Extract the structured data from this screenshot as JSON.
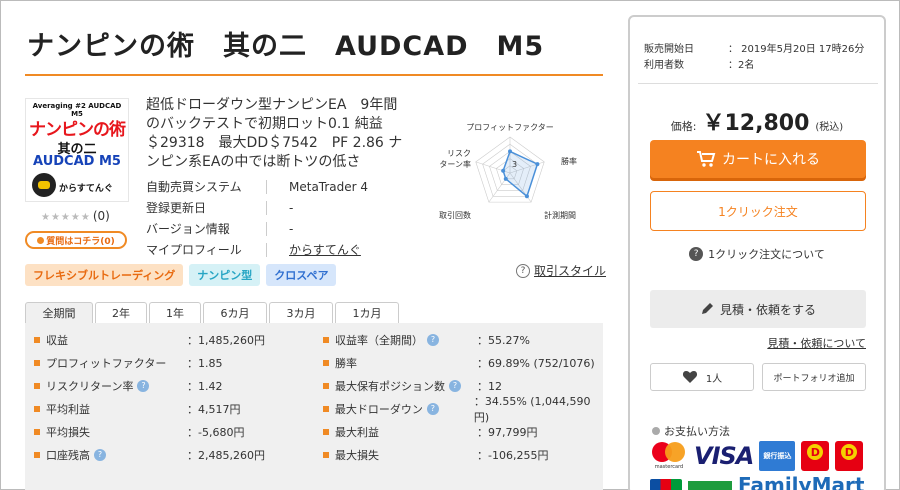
{
  "product": {
    "title": "ナンピンの術　其の二　AUDCAD　M5",
    "thumbnail": {
      "header": "Averaging #2 AUDCAD M5",
      "line1": "ナンピンの術",
      "line2": "其の二",
      "line3": "AUDCAD M5",
      "line4": "からすてんぐ"
    },
    "rating_stars": "★★★★★",
    "rating_count": "(0)",
    "qa_button": "質問はコチラ(0)",
    "description": "超低ドローダウン型ナンピンEA　9年間のバックテストで初期ロット0.1 純益　＄29318　最大DD＄7542　PF 2.86 ナンピン系EAの中では断トツの低さ",
    "meta": [
      {
        "label": "自動売買システム",
        "value": "MetaTrader 4"
      },
      {
        "label": "登録更新日",
        "value": "-"
      },
      {
        "label": "バージョン情報",
        "value": "-"
      },
      {
        "label": "マイプロフィール",
        "value": "からすてんぐ"
      }
    ],
    "radar": {
      "labels": [
        "プロフィットファクター",
        "勝率",
        "計測期間",
        "取引回数",
        "リスク\nターン率"
      ],
      "values": [
        3,
        4,
        4,
        1,
        1
      ],
      "center_label": "3"
    },
    "tags": [
      "フレキシブルトレーディング",
      "ナンピン型",
      "クロスペア"
    ],
    "trade_style_link": "取引スタイル"
  },
  "stats_tabs": [
    "全期間",
    "2年",
    "1年",
    "6カ月",
    "3カ月",
    "1カ月"
  ],
  "stats": [
    {
      "l_label": "収益",
      "l_value": "：1,485,260円",
      "l_hint": false,
      "r_label": "収益率（全期間）",
      "r_value": "：55.27%",
      "r_hint": true
    },
    {
      "l_label": "プロフィットファクター",
      "l_value": "：1.85",
      "l_hint": false,
      "r_label": "勝率",
      "r_value": "：69.89% (752/1076)",
      "r_hint": false
    },
    {
      "l_label": "リスクリターン率",
      "l_value": "：1.42",
      "l_hint": true,
      "r_label": "最大保有ポジション数",
      "r_value": "：12",
      "r_hint": true
    },
    {
      "l_label": "平均利益",
      "l_value": "：4,517円",
      "l_hint": false,
      "r_label": "最大ドローダウン",
      "r_value": "：34.55% (1,044,590円)",
      "r_hint": true
    },
    {
      "l_label": "平均損失",
      "l_value": "：-5,680円",
      "l_hint": false,
      "r_label": "最大利益",
      "r_value": "：97,799円",
      "r_hint": false
    },
    {
      "l_label": "口座残高",
      "l_value": "：2,485,260円",
      "l_hint": true,
      "r_label": "最大損失",
      "r_value": "：-106,255円",
      "r_hint": false
    }
  ],
  "side": {
    "sale_start_label": "販売開始日",
    "sale_start_value": "：  2019年5月20日 17時26分",
    "users_label": "利用者数",
    "users_value": "：2名",
    "price_label": "価格:",
    "price_value": "￥12,800",
    "price_tax": "(税込)",
    "cart_button": "カートに入れる",
    "oneclick_button": "1クリック注文",
    "about_oneclick": "1クリック注文について",
    "quote_button": "見積・依頼をする",
    "quote_link": "見積・依頼について",
    "fav_count": "1人",
    "portfolio_button": "ポートフォリオ追加",
    "payment_title": "お支払い方法",
    "payments": {
      "mastercard": "mastercard",
      "visa": "VISA",
      "bank": "銀行振込",
      "familymart": "FamilyMart"
    }
  },
  "colors": {
    "accent": "#f08a24",
    "cart": "#f58220",
    "radar": "#4a90d9"
  }
}
